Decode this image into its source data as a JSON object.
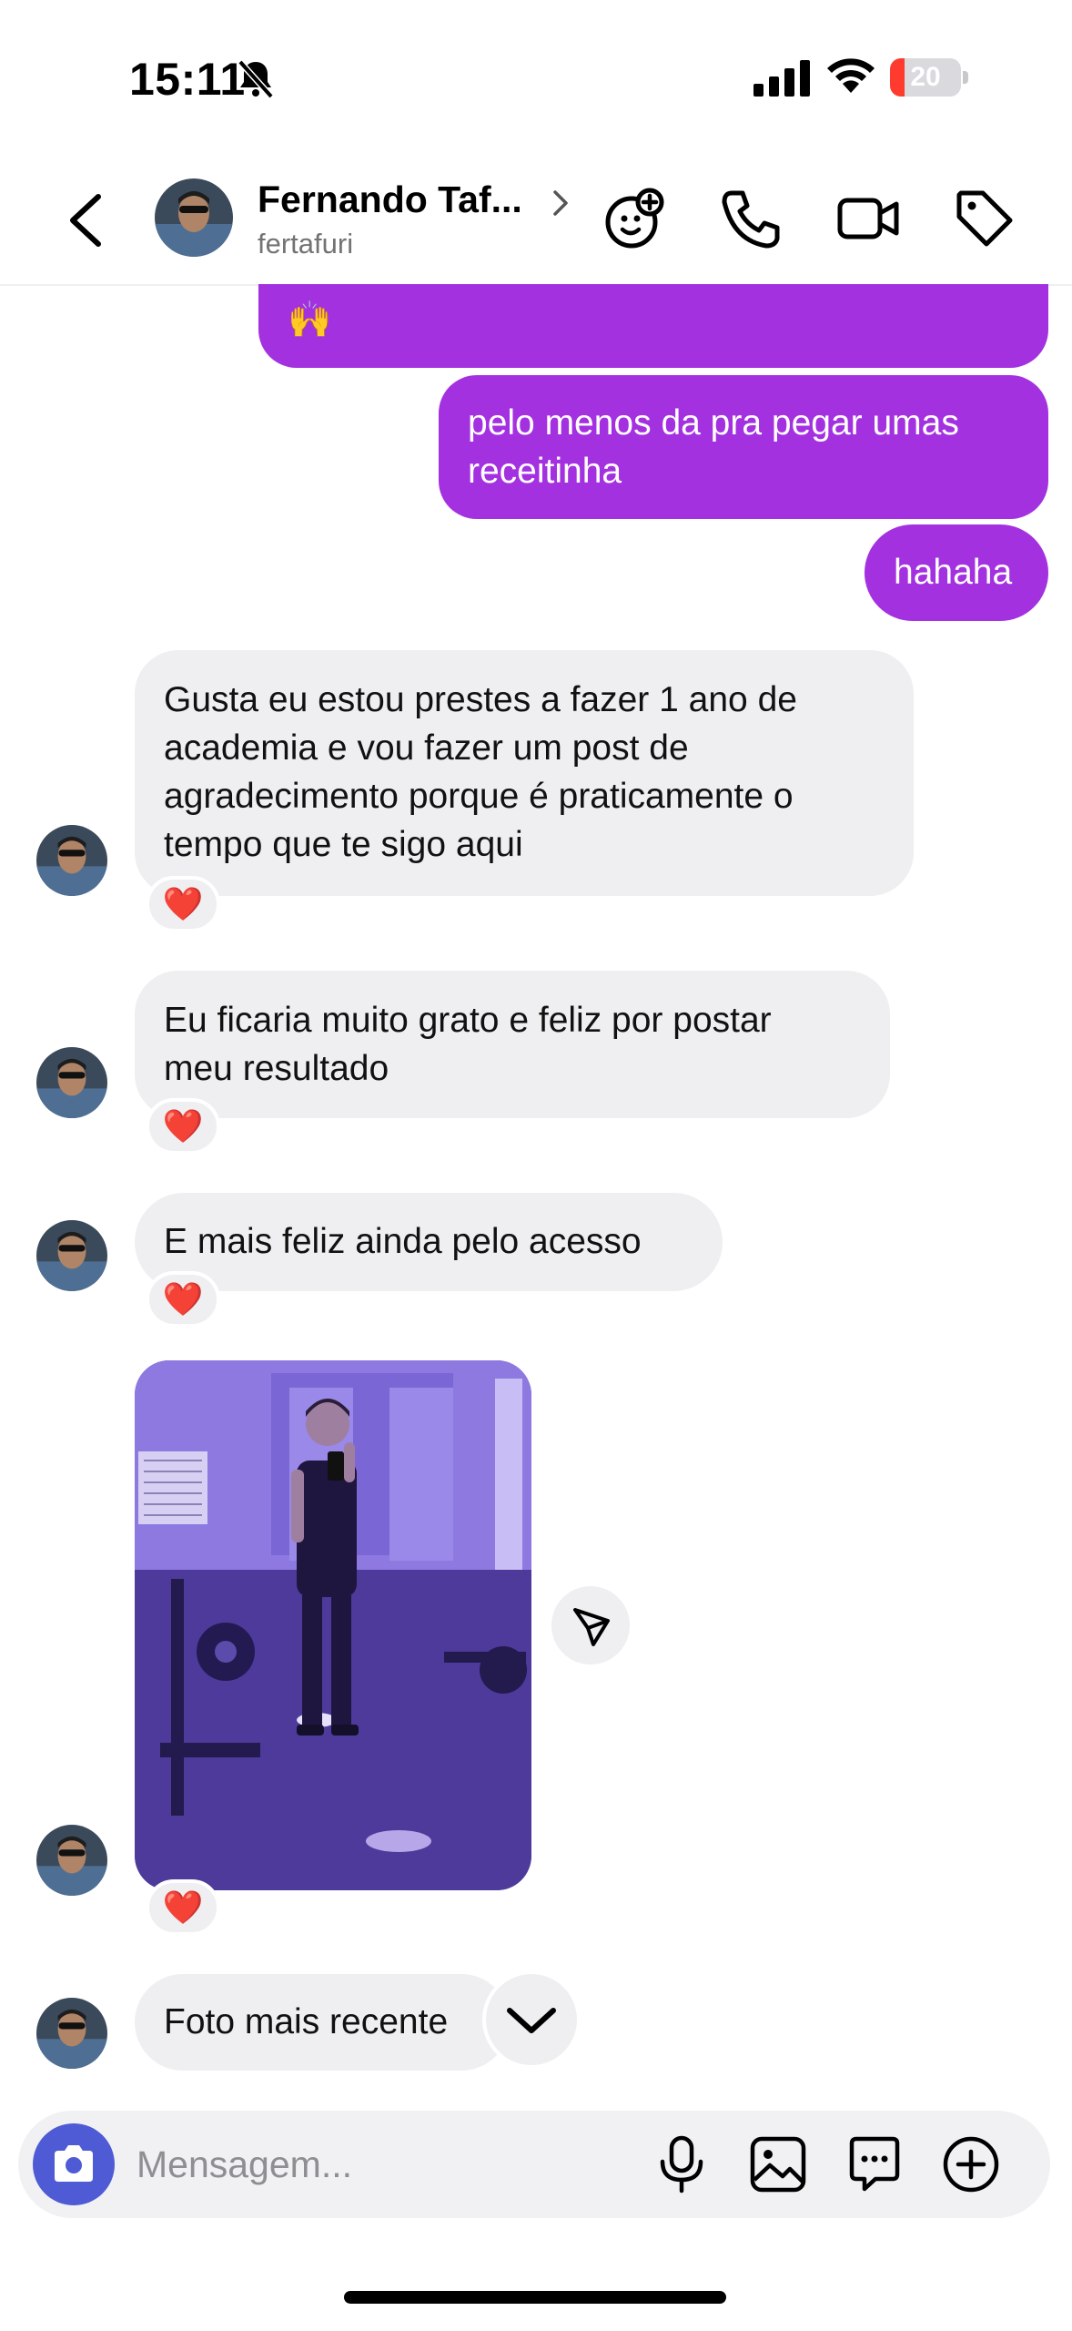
{
  "status_bar": {
    "time": "15:11",
    "battery_level": "20",
    "battery_fraction": 0.2,
    "icons": [
      "bell-slash-icon",
      "cellular-signal-icon",
      "wifi-icon",
      "battery-icon"
    ]
  },
  "header": {
    "name": "Fernando Taf...",
    "username": "fertafuri",
    "icons": [
      "back-icon",
      "chevron-right-icon",
      "add-effect-icon",
      "phone-icon",
      "video-icon",
      "tag-icon"
    ]
  },
  "messages": {
    "out_partial_emoji": "🙌",
    "out_1": [
      "pelo menos da pra pegar umas",
      "receitinha"
    ],
    "out_2": "hahaha",
    "in_1": [
      "Gusta eu estou prestes a fazer 1 ano de",
      "academia e vou fazer um post de",
      "agradecimento porque é praticamente o",
      "tempo que te sigo aqui"
    ],
    "in_2": [
      "Eu ficaria muito grato e feliz por postar",
      "meu resultado"
    ],
    "in_3": "E mais feliz ainda pelo acesso",
    "in_5": "Foto mais recente",
    "reaction": "❤️"
  },
  "composer": {
    "placeholder": "Mensagem...",
    "icons": [
      "camera-icon",
      "microphone-icon",
      "gallery-icon",
      "sticker-chat-icon",
      "plus-circle-icon"
    ]
  },
  "colors": {
    "outgoing_bubble": "#a431e0",
    "incoming_bubble": "#efeff1",
    "camera_button": "#4f5bd5",
    "heart": "#e41d3b"
  }
}
